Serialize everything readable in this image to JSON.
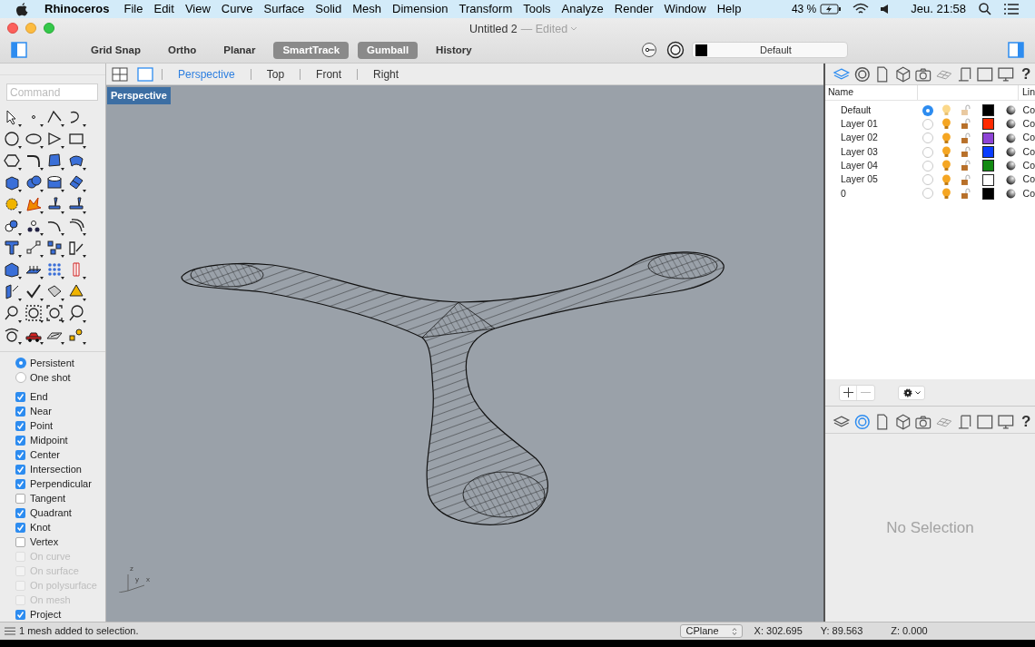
{
  "menu_bar": {
    "app": "Rhinoceros",
    "items": [
      "File",
      "Edit",
      "View",
      "Curve",
      "Surface",
      "Solid",
      "Mesh",
      "Dimension",
      "Transform",
      "Tools",
      "Analyze",
      "Render",
      "Window",
      "Help"
    ],
    "battery": "43 %",
    "clock": "Jeu. 21:58"
  },
  "window": {
    "title": "Untitled 2",
    "edited": "— Edited"
  },
  "toolbar": {
    "toggles": [
      {
        "label": "Grid Snap",
        "on": false
      },
      {
        "label": "Ortho",
        "on": false
      },
      {
        "label": "Planar",
        "on": false
      },
      {
        "label": "SmartTrack",
        "on": true
      },
      {
        "label": "Gumball",
        "on": true
      },
      {
        "label": "History",
        "on": false
      }
    ],
    "layer": {
      "name": "Default",
      "color": "#000000"
    }
  },
  "viewport_tabs": [
    {
      "label": "Perspective",
      "selected": true
    },
    {
      "label": "Top",
      "selected": false
    },
    {
      "label": "Front",
      "selected": false
    },
    {
      "label": "Right",
      "selected": false
    }
  ],
  "viewport": {
    "label": "Perspective",
    "axes": [
      "z",
      "y",
      "x"
    ]
  },
  "command": {
    "placeholder": "Command"
  },
  "osnap": {
    "modes": [
      {
        "label": "Persistent",
        "selected": true
      },
      {
        "label": "One shot",
        "selected": false
      }
    ],
    "snaps": [
      {
        "label": "End",
        "checked": true,
        "disabled": false
      },
      {
        "label": "Near",
        "checked": true,
        "disabled": false
      },
      {
        "label": "Point",
        "checked": true,
        "disabled": false
      },
      {
        "label": "Midpoint",
        "checked": true,
        "disabled": false
      },
      {
        "label": "Center",
        "checked": true,
        "disabled": false
      },
      {
        "label": "Intersection",
        "checked": true,
        "disabled": false
      },
      {
        "label": "Perpendicular",
        "checked": true,
        "disabled": false
      },
      {
        "label": "Tangent",
        "checked": false,
        "disabled": false
      },
      {
        "label": "Quadrant",
        "checked": true,
        "disabled": false
      },
      {
        "label": "Knot",
        "checked": true,
        "disabled": false
      },
      {
        "label": "Vertex",
        "checked": false,
        "disabled": false
      },
      {
        "label": "On curve",
        "checked": false,
        "disabled": true
      },
      {
        "label": "On surface",
        "checked": false,
        "disabled": true
      },
      {
        "label": "On polysurface",
        "checked": false,
        "disabled": true
      },
      {
        "label": "On mesh",
        "checked": false,
        "disabled": true
      },
      {
        "label": "Project",
        "checked": true,
        "disabled": false
      }
    ]
  },
  "panel_tabs": [
    {
      "kind": "layers",
      "selected": true
    },
    {
      "kind": "material",
      "selected": false
    },
    {
      "kind": "page",
      "selected": false
    },
    {
      "kind": "box",
      "selected": false
    },
    {
      "kind": "camera",
      "selected": false
    },
    {
      "kind": "grid",
      "selected": false
    },
    {
      "kind": "scroll",
      "selected": false
    },
    {
      "kind": "frame",
      "selected": false
    },
    {
      "kind": "monitor",
      "selected": false
    },
    {
      "kind": "help",
      "label": "?",
      "selected": false
    }
  ],
  "layers": {
    "columns": [
      "Name",
      "Lin"
    ],
    "rows": [
      {
        "name": "Default",
        "selected": true,
        "color": "#000000",
        "linetype": "Co"
      },
      {
        "name": "Layer 01",
        "selected": false,
        "color": "#ff2a00",
        "linetype": "Co"
      },
      {
        "name": "Layer 02",
        "selected": false,
        "color": "#8e44d6",
        "linetype": "Co"
      },
      {
        "name": "Layer 03",
        "selected": false,
        "color": "#0a3dff",
        "linetype": "Co"
      },
      {
        "name": "Layer 04",
        "selected": false,
        "color": "#128a12",
        "linetype": "Co"
      },
      {
        "name": "Layer 05",
        "selected": false,
        "color": "#ffffff",
        "linetype": "Co"
      },
      {
        "name": "0",
        "selected": false,
        "color": "#000000",
        "linetype": "Co"
      }
    ]
  },
  "properties_tabs": [
    {
      "kind": "layers",
      "selected": false
    },
    {
      "kind": "material",
      "selected": true
    },
    {
      "kind": "page",
      "selected": false
    },
    {
      "kind": "box",
      "selected": false
    },
    {
      "kind": "camera",
      "selected": false
    },
    {
      "kind": "grid",
      "selected": false
    },
    {
      "kind": "scroll",
      "selected": false
    },
    {
      "kind": "frame",
      "selected": false
    },
    {
      "kind": "monitor",
      "selected": false
    },
    {
      "kind": "help",
      "label": "?",
      "selected": false
    }
  ],
  "properties": {
    "empty": "No Selection"
  },
  "status_bar": {
    "message": "1 mesh added to selection.",
    "cplane": "CPlane",
    "x": "X: 302.695",
    "y": "Y: 89.563",
    "z": "Z: 0.000"
  }
}
